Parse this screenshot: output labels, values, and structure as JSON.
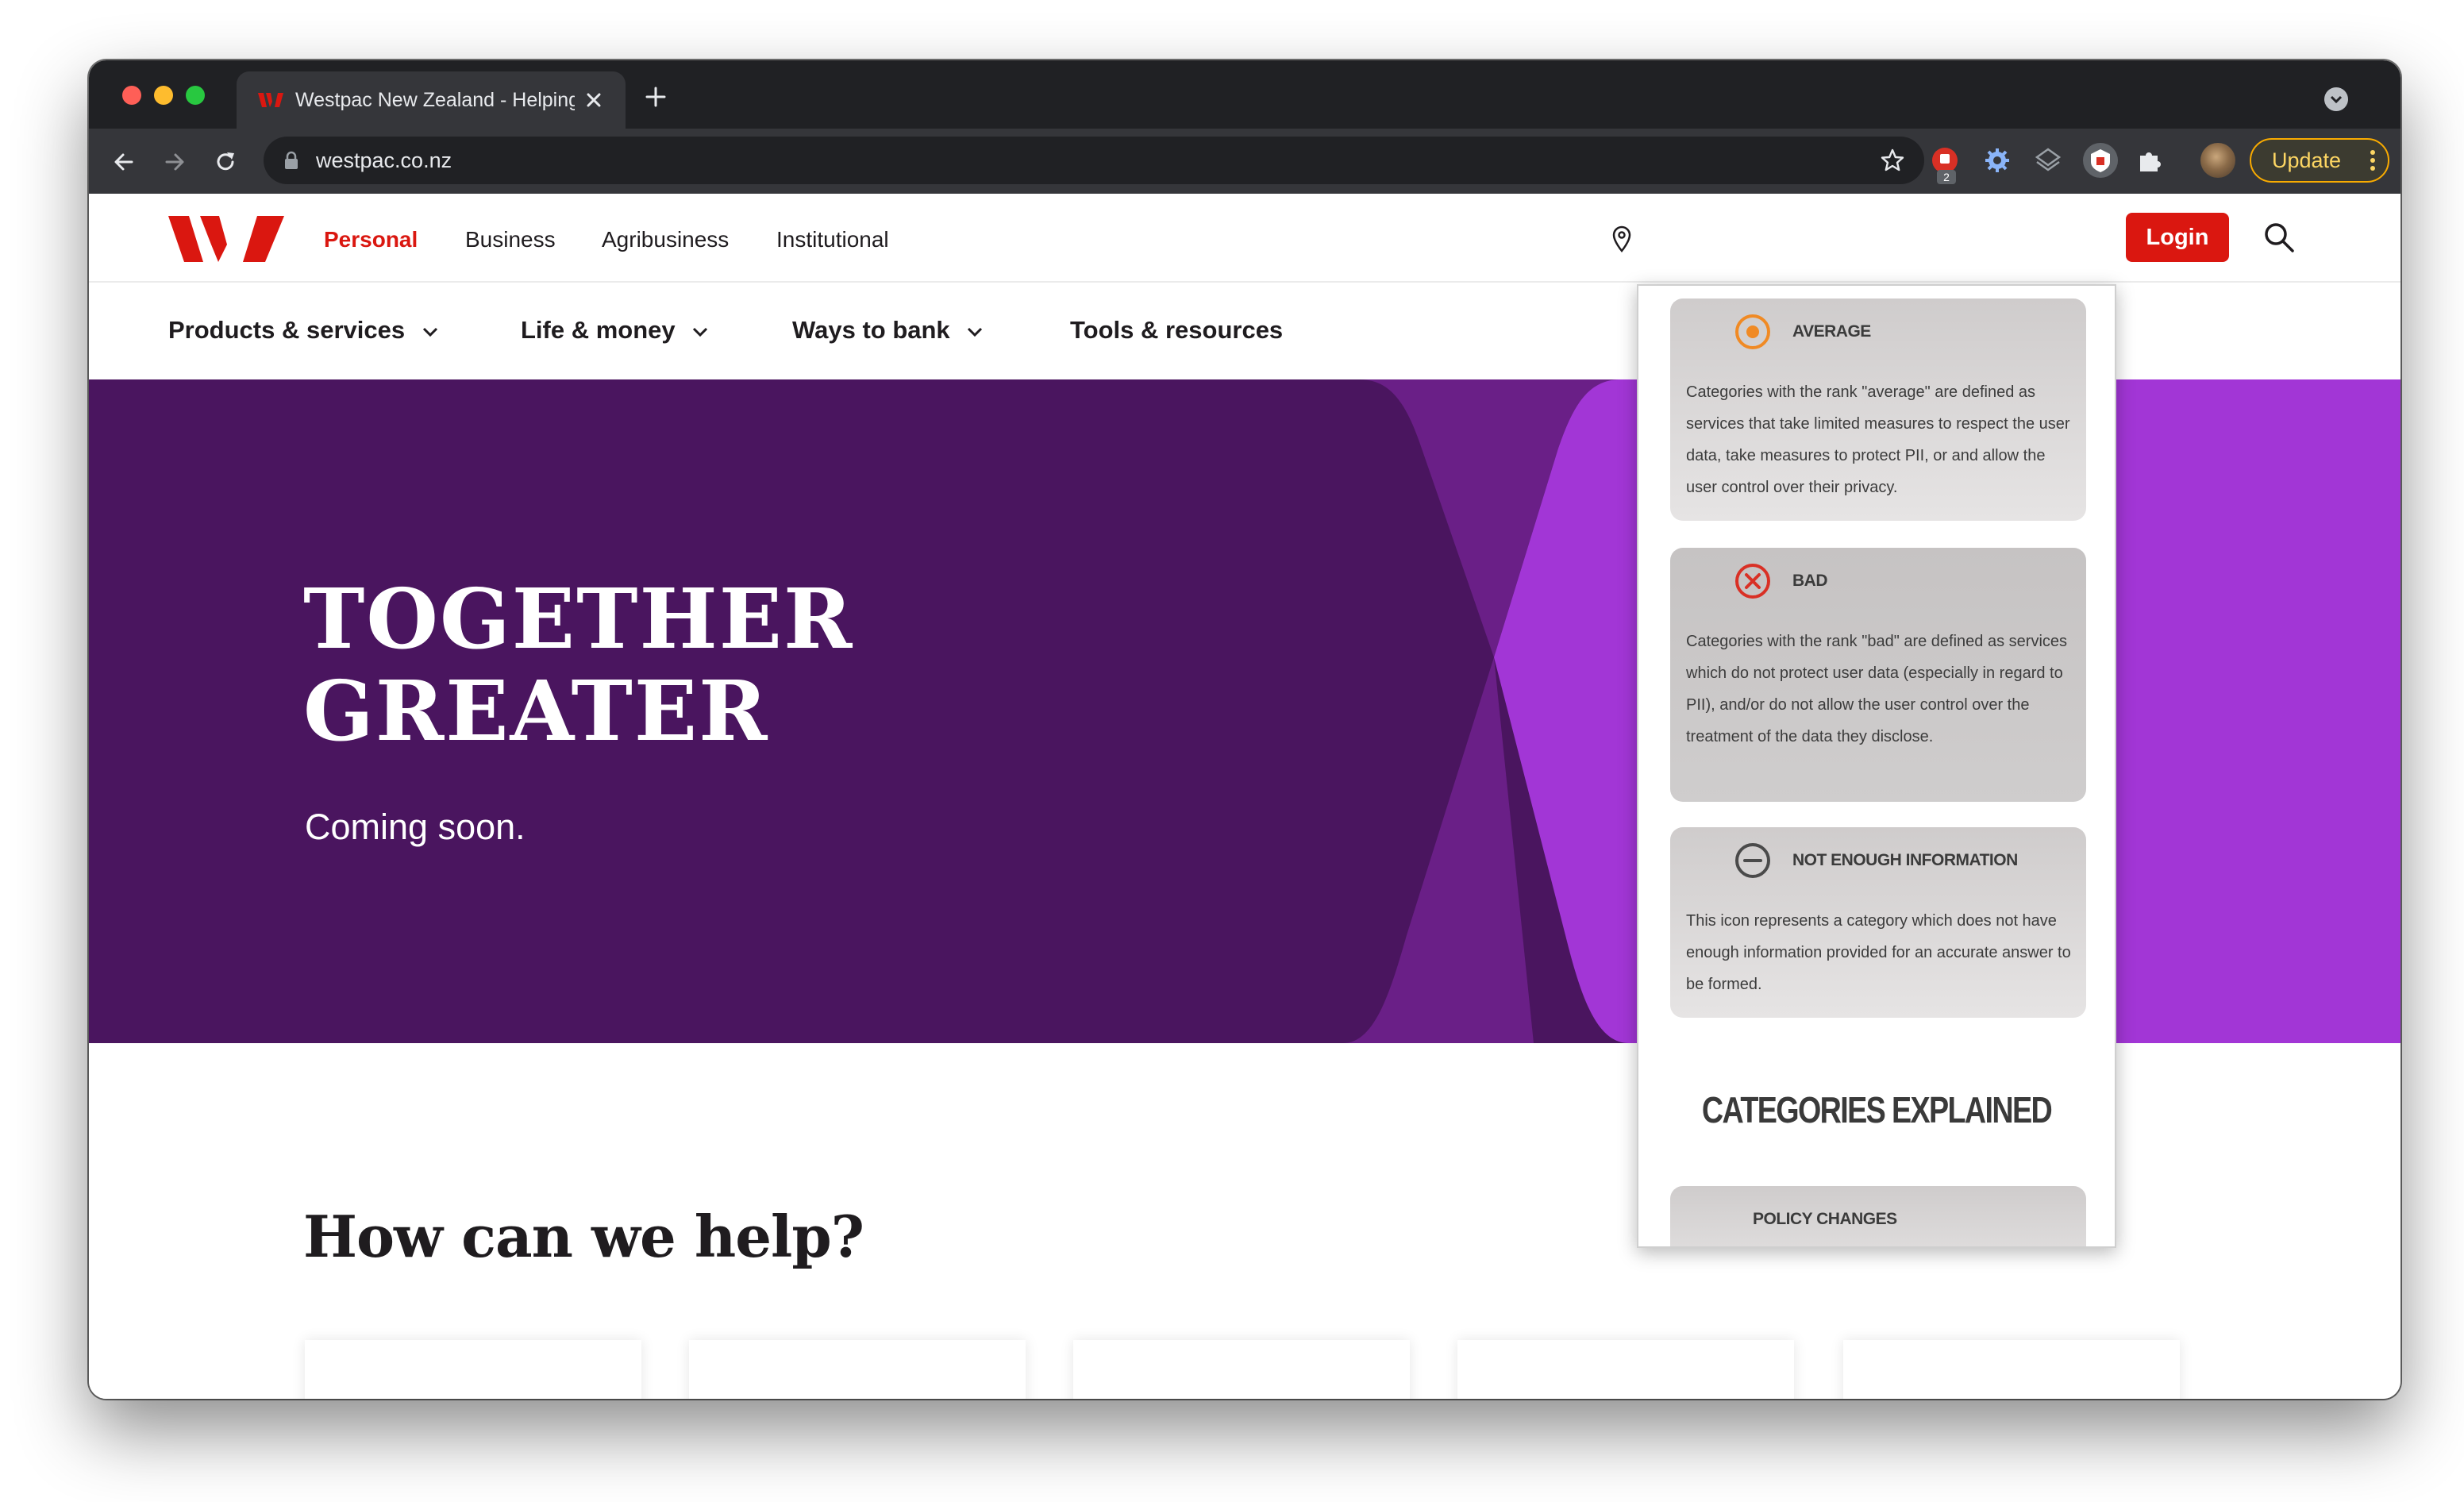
{
  "browser": {
    "tab_title": "Westpac New Zealand - Helping",
    "url": "westpac.co.nz",
    "extension_badge": "2",
    "update_label": "Update"
  },
  "site": {
    "segments": [
      "Personal",
      "Business",
      "Agribusiness",
      "Institutional"
    ],
    "login_label": "Login",
    "main_nav": [
      "Products & services",
      "Life & money",
      "Ways to bank",
      "Tools & resources"
    ],
    "hero": {
      "title_line1": "TOGETHER",
      "title_line2": "GREATER",
      "subtitle": "Coming soon."
    },
    "help_title": "How can we help?",
    "colors": {
      "brand_red": "#da1710",
      "hero_dark": "#4a155f",
      "hero_light": "#a236d6"
    }
  },
  "extension_popup": {
    "cards": [
      {
        "title": "AVERAGE",
        "icon": "average-icon",
        "text": "Categories with the rank \"average\" are defined as services that take limited measures to respect the user data, take measures to protect PII, or and allow the user control over their privacy."
      },
      {
        "title": "BAD",
        "icon": "bad-icon",
        "text": "Categories with the rank \"bad\" are defined as services which do not protect user data (especially in regard to PII), and/or do not allow the user control over the treatment of the data they disclose."
      },
      {
        "title": "NOT ENOUGH INFORMATION",
        "icon": "not-enough-info-icon",
        "text": "This icon represents a category which does not have enough information provided for an accurate answer to be formed."
      }
    ],
    "section_heading": "CATEGORIES EXPLAINED",
    "policy_card_title": "POLICY CHANGES"
  }
}
